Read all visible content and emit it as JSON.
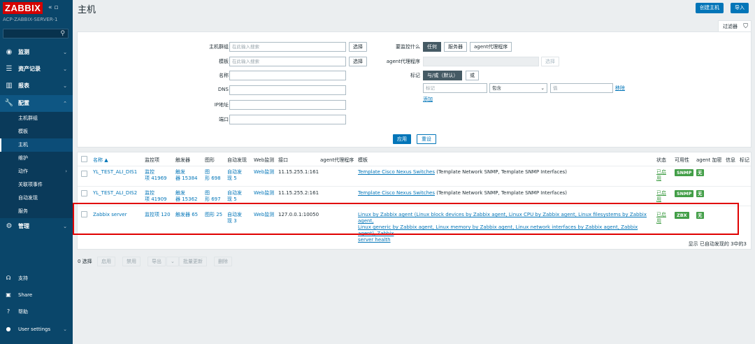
{
  "sidebar": {
    "logo": "ZABBIX",
    "server": "ACP-ZABBIX-SERVER-1",
    "nav": [
      {
        "label": "监测",
        "icon": "eye-icon"
      },
      {
        "label": "资产记录",
        "icon": "list-icon"
      },
      {
        "label": "报表",
        "icon": "chart-icon"
      },
      {
        "label": "配置",
        "icon": "wrench-icon"
      },
      {
        "label": "管理",
        "icon": "gear-icon"
      }
    ],
    "config_items": [
      "主机群组",
      "模板",
      "主机",
      "维护",
      "动作",
      "关联项事件",
      "自动发现",
      "服务"
    ],
    "bottom": [
      {
        "label": "支持",
        "icon": "headset-icon"
      },
      {
        "label": "Share",
        "icon": "share-icon"
      },
      {
        "label": "帮助",
        "icon": "help-icon"
      },
      {
        "label": "User settings",
        "icon": "user-icon"
      }
    ]
  },
  "header": {
    "title": "主机",
    "create_btn": "创建主机",
    "import_btn": "导入"
  },
  "filter": {
    "tab_label": "过滤器",
    "host_group_label": "主机群组",
    "host_group_placeholder": "在此输入搜索",
    "select_btn": "选择",
    "template_label": "模板",
    "template_placeholder": "在此输入搜索",
    "name_label": "名称",
    "dns_label": "DNS",
    "ip_label": "IP地址",
    "port_label": "端口",
    "monitored_by_label": "要监控什么",
    "monitored_by_options": [
      "任何",
      "服务器",
      "agent代理程序"
    ],
    "proxy_label": "agent代理程序",
    "proxy_select_btn": "选择",
    "tags_label": "标记",
    "tag_mode_options": [
      "与/或（默认）",
      "或"
    ],
    "tag_placeholder": "标记",
    "tag_op": "包含",
    "tag_value_placeholder": "值",
    "tag_remove": "移除",
    "tag_add": "添加",
    "apply_btn": "应用",
    "reset_btn": "重设"
  },
  "table": {
    "headers": {
      "name": "名称 ▲",
      "items": "监控项",
      "triggers": "触发器",
      "graphs": "图形",
      "discovery": "自动发现",
      "web": "Web监测",
      "interface": "接口",
      "proxy": "agent代理程序",
      "templates": "模板",
      "status": "状态",
      "availability": "可用性",
      "encryption": "agent 加密",
      "info": "信息",
      "tags": "标记"
    },
    "rows": [
      {
        "name": "YL_TEST_ALI_DIS1",
        "items_a": "监控",
        "items_b": "项 41969",
        "triggers_a": "触发",
        "triggers_b": "器 15384",
        "graphs_a": "图",
        "graphs_b": "形 698",
        "disc_a": "自动发",
        "disc_b": "现 5",
        "web": "Web监测",
        "interface": "11.15.255.1:161",
        "tmpl_main": "Template Cisco Nexus Switches",
        "tmpl_paren": "(Template Network SNMP, Template SNMP Interfaces)",
        "status_a": "已启",
        "status_b": "用",
        "avail": "SNMP",
        "enc": "无"
      },
      {
        "name": "YL_TEST_ALI_DIS2",
        "items_a": "监控",
        "items_b": "项 41909",
        "triggers_a": "触发",
        "triggers_b": "器 15362",
        "graphs_a": "图",
        "graphs_b": "形 697",
        "disc_a": "自动发",
        "disc_b": "现 5",
        "web": "Web监测",
        "interface": "11.15.255.2:161",
        "tmpl_main": "Template Cisco Nexus Switches",
        "tmpl_paren": "(Template Network SNMP, Template SNMP Interfaces)",
        "status_a": "已启",
        "status_b": "用",
        "avail": "SNMP",
        "enc": "无"
      },
      {
        "name": "Zabbix server",
        "items_a": "监控项 120",
        "triggers_a": "触发器 65",
        "graphs_a": "图形 25",
        "disc_a": "自动发",
        "disc_b": "现 3",
        "web": "Web监测",
        "interface": "127.0.0.1:10050",
        "tmpl_line1": "Linux by Zabbix agent (Linux block devices by Zabbix agent, Linux CPU by Zabbix agent, Linux filesystems by Zabbix agent,",
        "tmpl_line2": "Linux generic by Zabbix agent, Linux memory by Zabbix agent, Linux network interfaces by Zabbix agent, Zabbix agent), Zabbix",
        "tmpl_line3": "server health",
        "status_a": "已启",
        "status_b": "用",
        "avail": "ZBX",
        "enc": "无"
      }
    ],
    "footer": "显示 已自动发现的 3中的3"
  },
  "bulk": {
    "selected": "0 选择",
    "enable": "启用",
    "disable": "禁用",
    "export": "导出",
    "export_arrow": "⌄",
    "mass_update": "批量更新",
    "delete": "删除"
  },
  "colors": {
    "sidebar": "#0a466a",
    "accent": "#0275b8",
    "green": "#429e47",
    "highlight": "#e00000"
  }
}
